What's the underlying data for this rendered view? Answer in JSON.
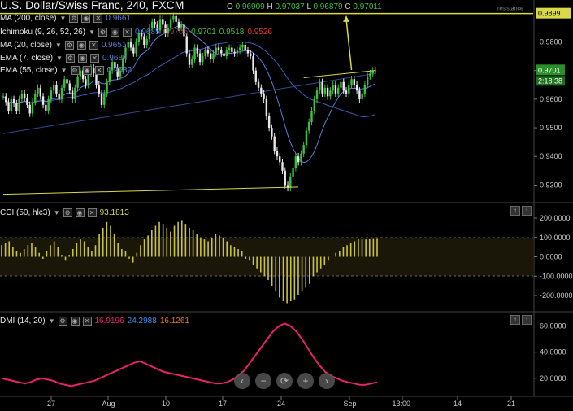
{
  "header": {
    "title": "U.S. Dollar/Swiss Franc, 240, FXCM",
    "ohlc_labels": [
      "O",
      "H",
      "L",
      "C"
    ],
    "ohlc_values": [
      "0.96909",
      "0.97037",
      "0.96879",
      "0.97011"
    ]
  },
  "indicators": [
    {
      "name": "MA (200, close)",
      "values": [
        "0.9661"
      ],
      "colors": [
        "#5b7fd6"
      ]
    },
    {
      "name": "Ichimoku (9, 26, 52, 26)",
      "values": [
        "0.9685",
        "0.9705",
        "0.9701",
        "0.9518",
        "0.9526"
      ],
      "colors": [
        "#3f78c8",
        "#7b3f3f",
        "#3fbf3f",
        "#3fbf3f",
        "#e23a3a"
      ]
    },
    {
      "name": "MA (20, close)",
      "values": [
        "0.9651"
      ],
      "colors": [
        "#5b7fd6"
      ]
    },
    {
      "name": "EMA (7, close)",
      "values": [
        "0.9684"
      ],
      "colors": [
        "#5b7fd6"
      ]
    },
    {
      "name": "EMA (55, close)",
      "values": [
        "0.9632"
      ],
      "colors": [
        "#5b7fd6"
      ]
    }
  ],
  "price_axis": {
    "ticks": [
      "0.9800",
      "0.9700",
      "0.9600",
      "0.9500",
      "0.9400",
      "0.9300"
    ],
    "target_label": "0.9899",
    "target_sublabel": "resistance",
    "last_price": "0.9701",
    "countdown": "2:18:38"
  },
  "cci": {
    "name": "CCI (50, hlc3)",
    "value": "93.1813",
    "ticks": [
      "200.0000",
      "100.0000",
      "0.0000",
      "-100.0000",
      "-200.0000"
    ]
  },
  "dmi": {
    "name": "DMI (14, 20)",
    "values": [
      "16.9196",
      "24.2988",
      "16.1261"
    ],
    "colors": [
      "#e8236b",
      "#3d8ee6",
      "#e8722a"
    ],
    "ticks": [
      "60.0000",
      "40.0000",
      "20.0000"
    ]
  },
  "x_axis": {
    "ticks": [
      "27",
      "Aug",
      "10",
      "17",
      "24",
      "Sep",
      "13:00",
      "14",
      "21"
    ]
  },
  "nav_buttons": [
    "‹",
    "−",
    "⟳",
    "+",
    "›"
  ],
  "colors": {
    "up": "#3fbf3f",
    "down": "#e8e8e8",
    "trend": "#d8d84a",
    "cci": "#c9c440",
    "dmi": "#e8236b"
  },
  "chart_data": [
    {
      "type": "candlestick",
      "title": "U.S. Dollar/Swiss Franc, 240, FXCM",
      "ylim": [
        0.925,
        0.9935
      ],
      "close": [
        0.961,
        0.959,
        0.956,
        0.96,
        0.9585,
        0.956,
        0.96,
        0.962,
        0.9605,
        0.958,
        0.955,
        0.959,
        0.962,
        0.964,
        0.961,
        0.958,
        0.956,
        0.96,
        0.963,
        0.965,
        0.962,
        0.96,
        0.964,
        0.967,
        0.9655,
        0.963,
        0.96,
        0.964,
        0.968,
        0.97,
        0.967,
        0.965,
        0.969,
        0.971,
        0.969,
        0.965,
        0.962,
        0.958,
        0.962,
        0.966,
        0.97,
        0.973,
        0.971,
        0.968,
        0.97,
        0.974,
        0.978,
        0.98,
        0.978,
        0.976,
        0.98,
        0.983,
        0.982,
        0.979,
        0.981,
        0.985,
        0.987,
        0.986,
        0.984,
        0.988,
        0.986,
        0.983,
        0.985,
        0.988,
        0.989,
        0.987,
        0.985,
        0.986,
        0.982,
        0.976,
        0.972,
        0.974,
        0.978,
        0.976,
        0.973,
        0.975,
        0.977,
        0.976,
        0.974,
        0.976,
        0.978,
        0.977,
        0.976,
        0.975,
        0.977,
        0.978,
        0.9765,
        0.976,
        0.977,
        0.978,
        0.979,
        0.977,
        0.976,
        0.975,
        0.97,
        0.966,
        0.964,
        0.962,
        0.96,
        0.954,
        0.95,
        0.947,
        0.942,
        0.94,
        0.938,
        0.935,
        0.93,
        0.929,
        0.933,
        0.936,
        0.94,
        0.938,
        0.941,
        0.944,
        0.949,
        0.952,
        0.956,
        0.96,
        0.963,
        0.966,
        0.962,
        0.964,
        0.961,
        0.963,
        0.965,
        0.962,
        0.964,
        0.966,
        0.963,
        0.962,
        0.965,
        0.967,
        0.965,
        0.963,
        0.96,
        0.962,
        0.965,
        0.968,
        0.969,
        0.97,
        0.9701
      ],
      "trendlines": [
        {
          "name": "support",
          "from": {
            "bar": 0,
            "price": 0.929
          },
          "to": {
            "bar": 143,
            "price": 0.929
          }
        },
        {
          "name": "channel",
          "from": {
            "bar": 0,
            "price": 0.948
          },
          "to": {
            "bar": 140,
            "price": 0.968
          }
        },
        {
          "name": "target",
          "from": {
            "bar": 140,
            "price": 0.97
          },
          "to": {
            "bar": 140,
            "price": 0.9899
          }
        }
      ],
      "moving_averages": [
        {
          "name": "MA 200",
          "color": "#5b7fd6",
          "values": [
            0.95,
            0.9661
          ]
        },
        {
          "name": "EMA 55",
          "color": "#5b7fd6",
          "values": [
            0.955,
            0.9632
          ]
        }
      ]
    },
    {
      "type": "bar",
      "title": "CCI (50, hlc3)",
      "ylim": [
        -250,
        250
      ],
      "values": [
        60,
        70,
        80,
        50,
        30,
        20,
        40,
        60,
        70,
        50,
        20,
        -10,
        30,
        60,
        80,
        50,
        10,
        -20,
        10,
        40,
        70,
        90,
        80,
        50,
        30,
        60,
        120,
        150,
        180,
        160,
        120,
        70,
        40,
        30,
        -10,
        -30,
        20,
        60,
        90,
        110,
        140,
        160,
        180,
        170,
        150,
        130,
        160,
        180,
        190,
        170,
        150,
        140,
        120,
        100,
        90,
        80,
        100,
        120,
        110,
        100,
        80,
        60,
        50,
        40,
        30,
        -10,
        -20,
        -40,
        -60,
        -80,
        -100,
        -120,
        -150,
        -180,
        -210,
        -230,
        -240,
        -230,
        -220,
        -200,
        -180,
        -160,
        -140,
        -100,
        -80,
        -60,
        -40,
        -20,
        0,
        20,
        30,
        50,
        60,
        70,
        80,
        90,
        90,
        90,
        91,
        92,
        93.1813
      ]
    },
    {
      "type": "line",
      "title": "DMI (14, 20)",
      "ylim": [
        8,
        66
      ],
      "series": [
        {
          "name": "ADX",
          "color": "#e8236b",
          "values": [
            20,
            19,
            18,
            17,
            16,
            17,
            19,
            20,
            19,
            18,
            16,
            15,
            14,
            15,
            16,
            17,
            18,
            20,
            22,
            24,
            26,
            28,
            30,
            32,
            33,
            31,
            29,
            27,
            25,
            24,
            23,
            22,
            21,
            20,
            19,
            18,
            17,
            16,
            16,
            17,
            19,
            22,
            26,
            32,
            38,
            44,
            50,
            56,
            60,
            62,
            60,
            56,
            50,
            43,
            36,
            30,
            25,
            22,
            20,
            18,
            17,
            16,
            15,
            15,
            16,
            16.9196
          ]
        }
      ]
    }
  ]
}
